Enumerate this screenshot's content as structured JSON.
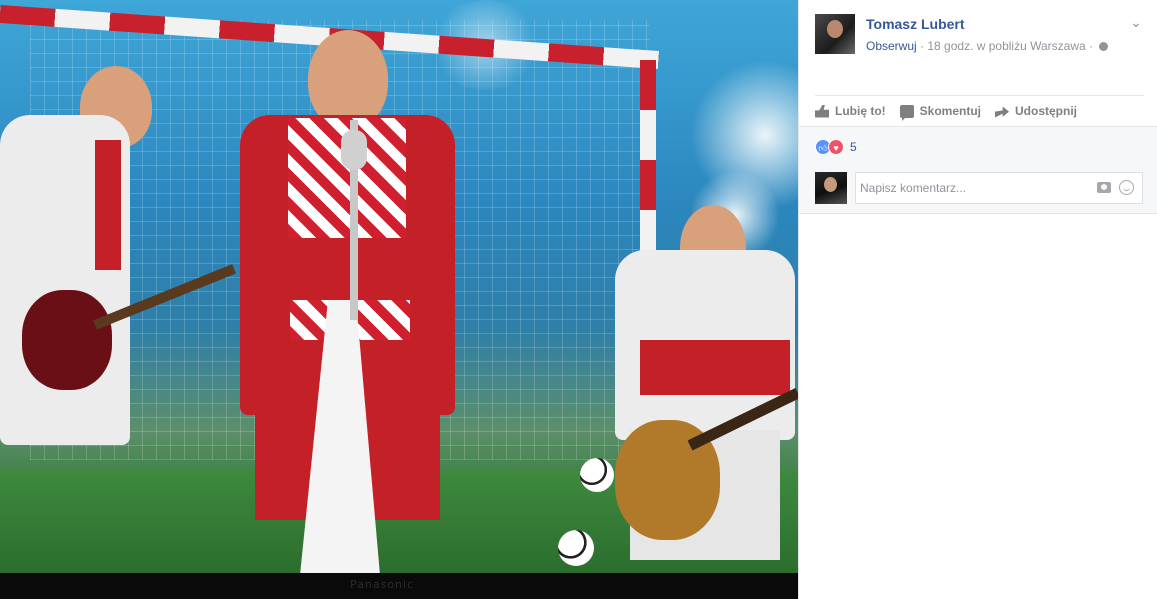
{
  "post": {
    "author_name": "Tomasz Lubert",
    "follow_label": "Obserwuj",
    "separator": "·",
    "time_location": "18 godz. w pobliżu Warszawa",
    "separator2": "·",
    "privacy_icon": "globe-icon",
    "menu_icon": "chevron-down-icon"
  },
  "actions": {
    "like_label": "Lubię to!",
    "comment_label": "Skomentuj",
    "share_label": "Udostępnij"
  },
  "reactions": {
    "types": [
      "like",
      "love"
    ],
    "count": "5"
  },
  "comment_input": {
    "placeholder": "Napisz komentarz..."
  },
  "photo": {
    "tv_brand": "Panasonic"
  },
  "colors": {
    "link_blue": "#365899",
    "meta_gray": "#90949c",
    "like_blue": "#5890ff",
    "love_red": "#f25268"
  }
}
